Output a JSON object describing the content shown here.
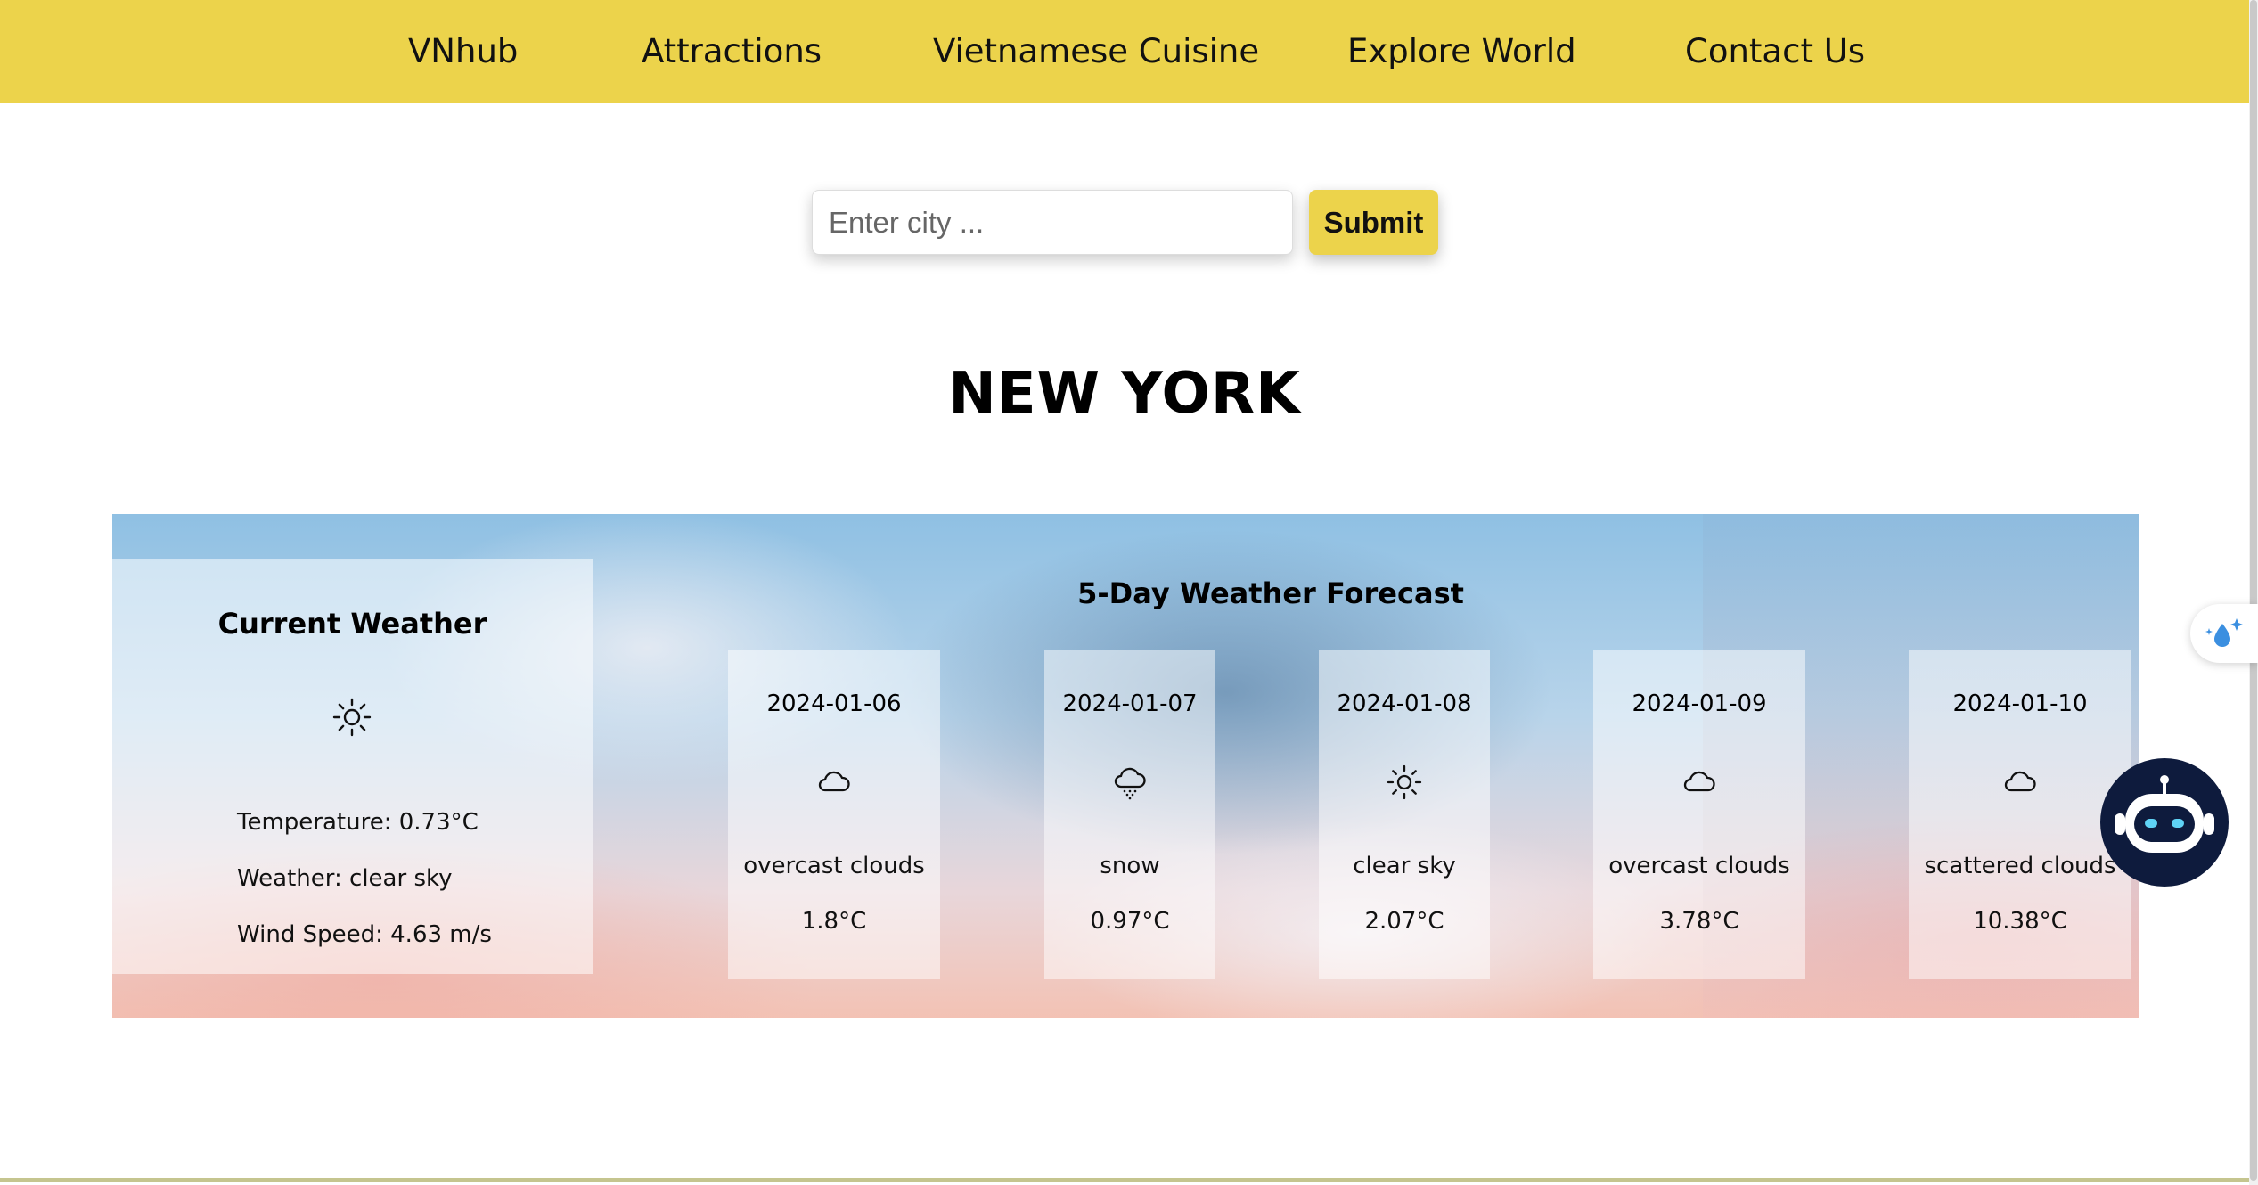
{
  "nav": {
    "items": [
      {
        "label": "VNhub"
      },
      {
        "label": "Attractions"
      },
      {
        "label": "Vietnamese Cuisine"
      },
      {
        "label": "Explore World"
      },
      {
        "label": "Contact Us"
      }
    ]
  },
  "search": {
    "placeholder": "Enter city ...",
    "value": "",
    "submit_label": "Submit"
  },
  "city": "NEW YORK",
  "current": {
    "heading": "Current Weather",
    "icon": "sun-icon",
    "temperature": "Temperature: 0.73°C",
    "weather": "Weather: clear sky",
    "wind": "Wind Speed: 4.63 m/s"
  },
  "forecast": {
    "heading": "5-Day Weather Forecast",
    "days": [
      {
        "date": "2024-01-06",
        "icon": "cloud-icon",
        "desc": "overcast clouds",
        "temp": "1.8°C"
      },
      {
        "date": "2024-01-07",
        "icon": "snow-cloud-icon",
        "desc": "snow",
        "temp": "0.97°C"
      },
      {
        "date": "2024-01-08",
        "icon": "sun-icon",
        "desc": "clear sky",
        "temp": "2.07°C"
      },
      {
        "date": "2024-01-09",
        "icon": "cloud-icon",
        "desc": "overcast clouds",
        "temp": "3.78°C"
      },
      {
        "date": "2024-01-10",
        "icon": "cloud-icon",
        "desc": "scattered clouds",
        "temp": "10.38°C"
      }
    ]
  },
  "colors": {
    "accent": "#ecd34b",
    "chatbot_bg": "#0e1b3d"
  }
}
